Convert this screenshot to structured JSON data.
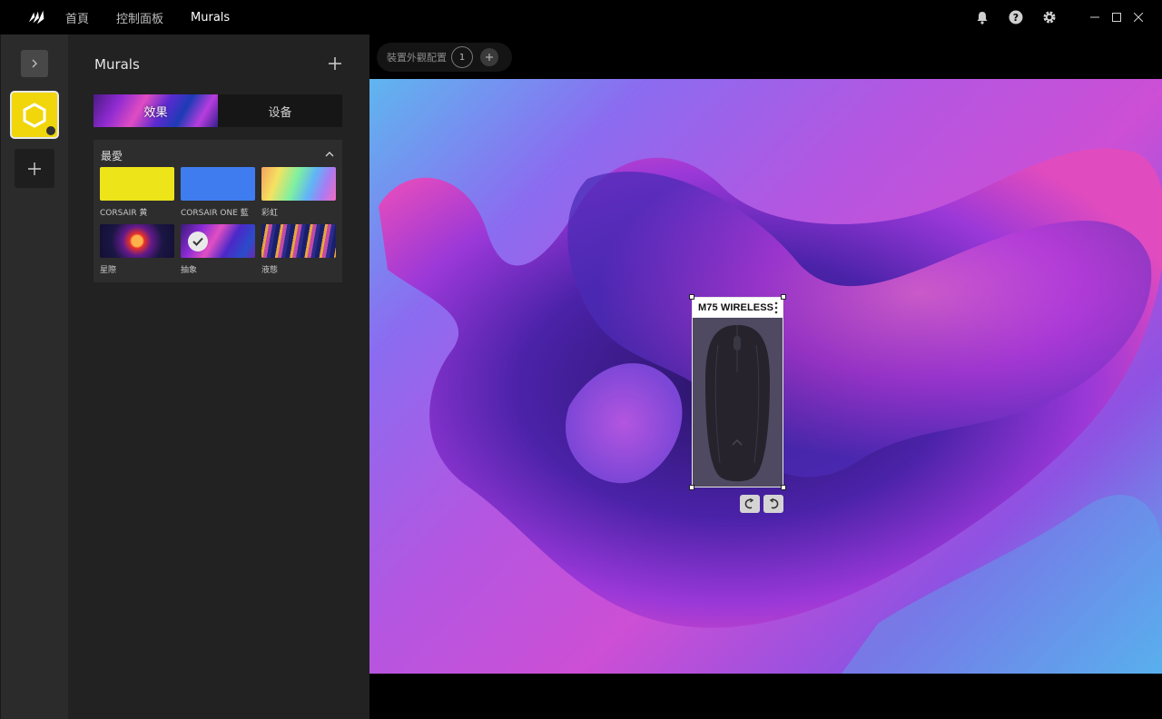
{
  "titlebar": {
    "nav": [
      {
        "label": "首頁",
        "active": false
      },
      {
        "label": "控制面板",
        "active": false
      },
      {
        "label": "Murals",
        "active": true
      }
    ],
    "icons": [
      "bell-icon",
      "help-icon",
      "gear-icon"
    ],
    "window_controls": [
      "minimize-icon",
      "maximize-icon",
      "close-icon"
    ]
  },
  "rail": {
    "profile_color": "#f0d60a",
    "add_icon": "plus-icon"
  },
  "panel": {
    "title": "Murals",
    "tabs": [
      {
        "label": "效果",
        "active": true
      },
      {
        "label": "设备",
        "active": false
      }
    ],
    "favorites": {
      "header": "最愛",
      "tiles": [
        {
          "label": "CORSAIR 黄",
          "style": "yellow",
          "selected": false
        },
        {
          "label": "CORSAIR ONE 藍",
          "style": "blue",
          "selected": false
        },
        {
          "label": "彩虹",
          "style": "rainbow",
          "selected": false
        },
        {
          "label": "星際",
          "style": "nebula",
          "selected": false
        },
        {
          "label": "抽象",
          "style": "abstract",
          "selected": true
        },
        {
          "label": "液態",
          "style": "liquid",
          "selected": false
        }
      ]
    }
  },
  "main": {
    "layout": {
      "label": "裝置外觀配置",
      "number": "1"
    },
    "device": {
      "name": "M75 WIRELESS"
    }
  },
  "colors": {
    "accent_yellow": "#f0d60a",
    "panel_bg": "#222222",
    "rail_bg": "#2b2b2b"
  }
}
